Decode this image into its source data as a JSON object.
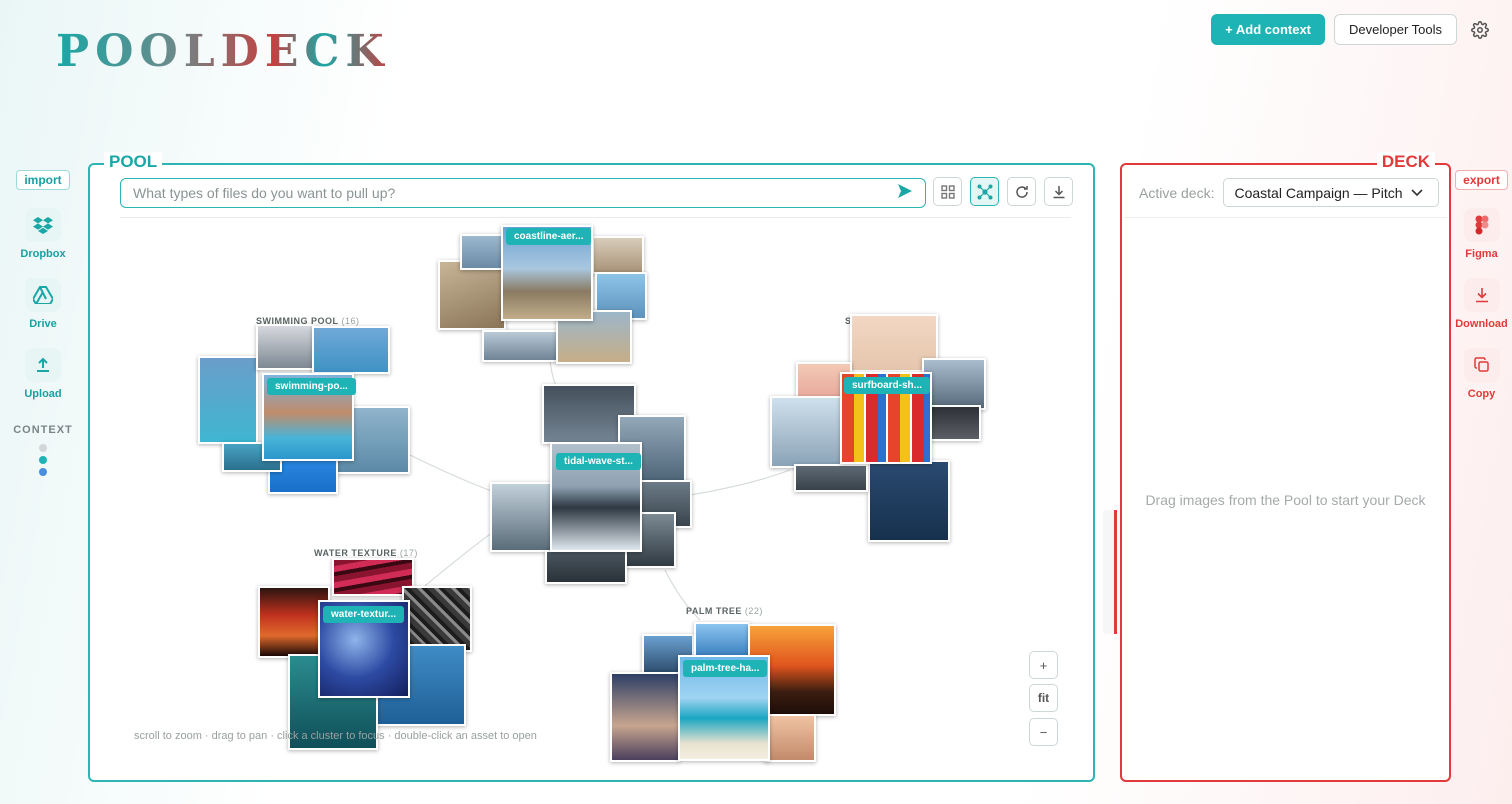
{
  "app": {
    "logo": "POOLDECK"
  },
  "topbar": {
    "add_context": "+ Add context",
    "developer_tools": "Developer Tools",
    "settings_icon": "gear-icon"
  },
  "import": {
    "tag": "import",
    "sources": [
      {
        "label": "Dropbox",
        "icon": "dropbox-icon"
      },
      {
        "label": "Drive",
        "icon": "drive-icon"
      },
      {
        "label": "Upload",
        "icon": "upload-icon"
      }
    ],
    "context_label": "CONTEXT",
    "context_dot_colors": [
      "#d3d6d6",
      "#1eb3b5",
      "#4a8ee0"
    ]
  },
  "pool": {
    "title": "POOL",
    "search_placeholder": "What types of files do you want to pull up?",
    "tools": [
      "grid-view-icon",
      "cluster-view-icon",
      "refresh-icon",
      "download-icon"
    ],
    "clusters": [
      {
        "name": "SWIMMING POOL",
        "count": "(16)",
        "pill": "swimming-po..."
      },
      {
        "name": "WATER TEXTURE",
        "count": "(17)",
        "pill": "water-textur..."
      },
      {
        "name": "PALM TREE",
        "count": "(22)",
        "pill": "palm-tree-ha..."
      },
      {
        "name": "S",
        "count": "",
        "pill": "surfboard-sh..."
      },
      {
        "name": "",
        "count": "",
        "pill": "coastline-aer..."
      },
      {
        "name": "",
        "count": "",
        "pill": "tidal-wave-st..."
      }
    ],
    "hint": "scroll to zoom · drag to pan · click a cluster to focus · double-click an asset to open",
    "zoom": {
      "plus": "+",
      "fit": "fit",
      "minus": "−"
    }
  },
  "deck": {
    "title": "DECK",
    "active_label": "Active deck:",
    "active_value": "Coastal Campaign — Pitch",
    "empty_text": "Drag images from the Pool to start your Deck"
  },
  "export": {
    "tag": "export",
    "targets": [
      {
        "label": "Figma",
        "icon": "figma-icon"
      },
      {
        "label": "Download",
        "icon": "download-icon"
      },
      {
        "label": "Copy",
        "icon": "copy-icon"
      }
    ]
  },
  "colors": {
    "pool_accent": "#1eb3b5",
    "deck_accent": "#e23a3a"
  }
}
